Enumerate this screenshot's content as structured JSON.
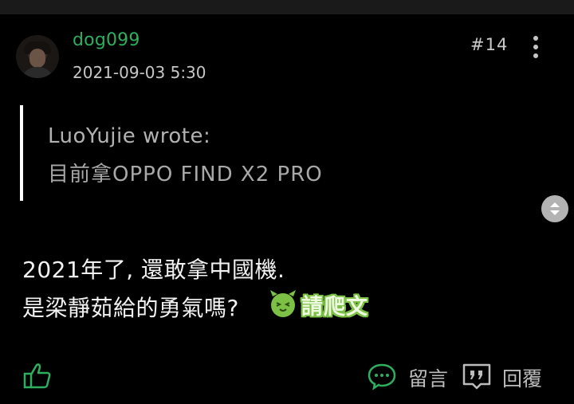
{
  "post": {
    "username": "dog099",
    "timestamp": "2021-09-03 5:30",
    "post_number": "#14"
  },
  "quote": {
    "author_line": "LuoYujie wrote:",
    "text": "目前拿OPPO FIND X2 PRO"
  },
  "content": {
    "line1": "2021年了, 還敢拿中國機.",
    "line2": "是梁靜茹給的勇氣嗎?",
    "sticker_text": "請爬文"
  },
  "actions": {
    "comment_label": "留言",
    "reply_label": "回覆"
  },
  "icons": {
    "more": "more-vertical-icon",
    "like": "thumbs-up-icon",
    "comment": "comment-bubble-icon",
    "reply": "quote-reply-icon",
    "scroll": "scroll-up-down-icon"
  },
  "colors": {
    "background": "#000000",
    "username": "#2eae5e",
    "accent_green": "#2eae5e",
    "quote_bar": "#ffffff"
  }
}
